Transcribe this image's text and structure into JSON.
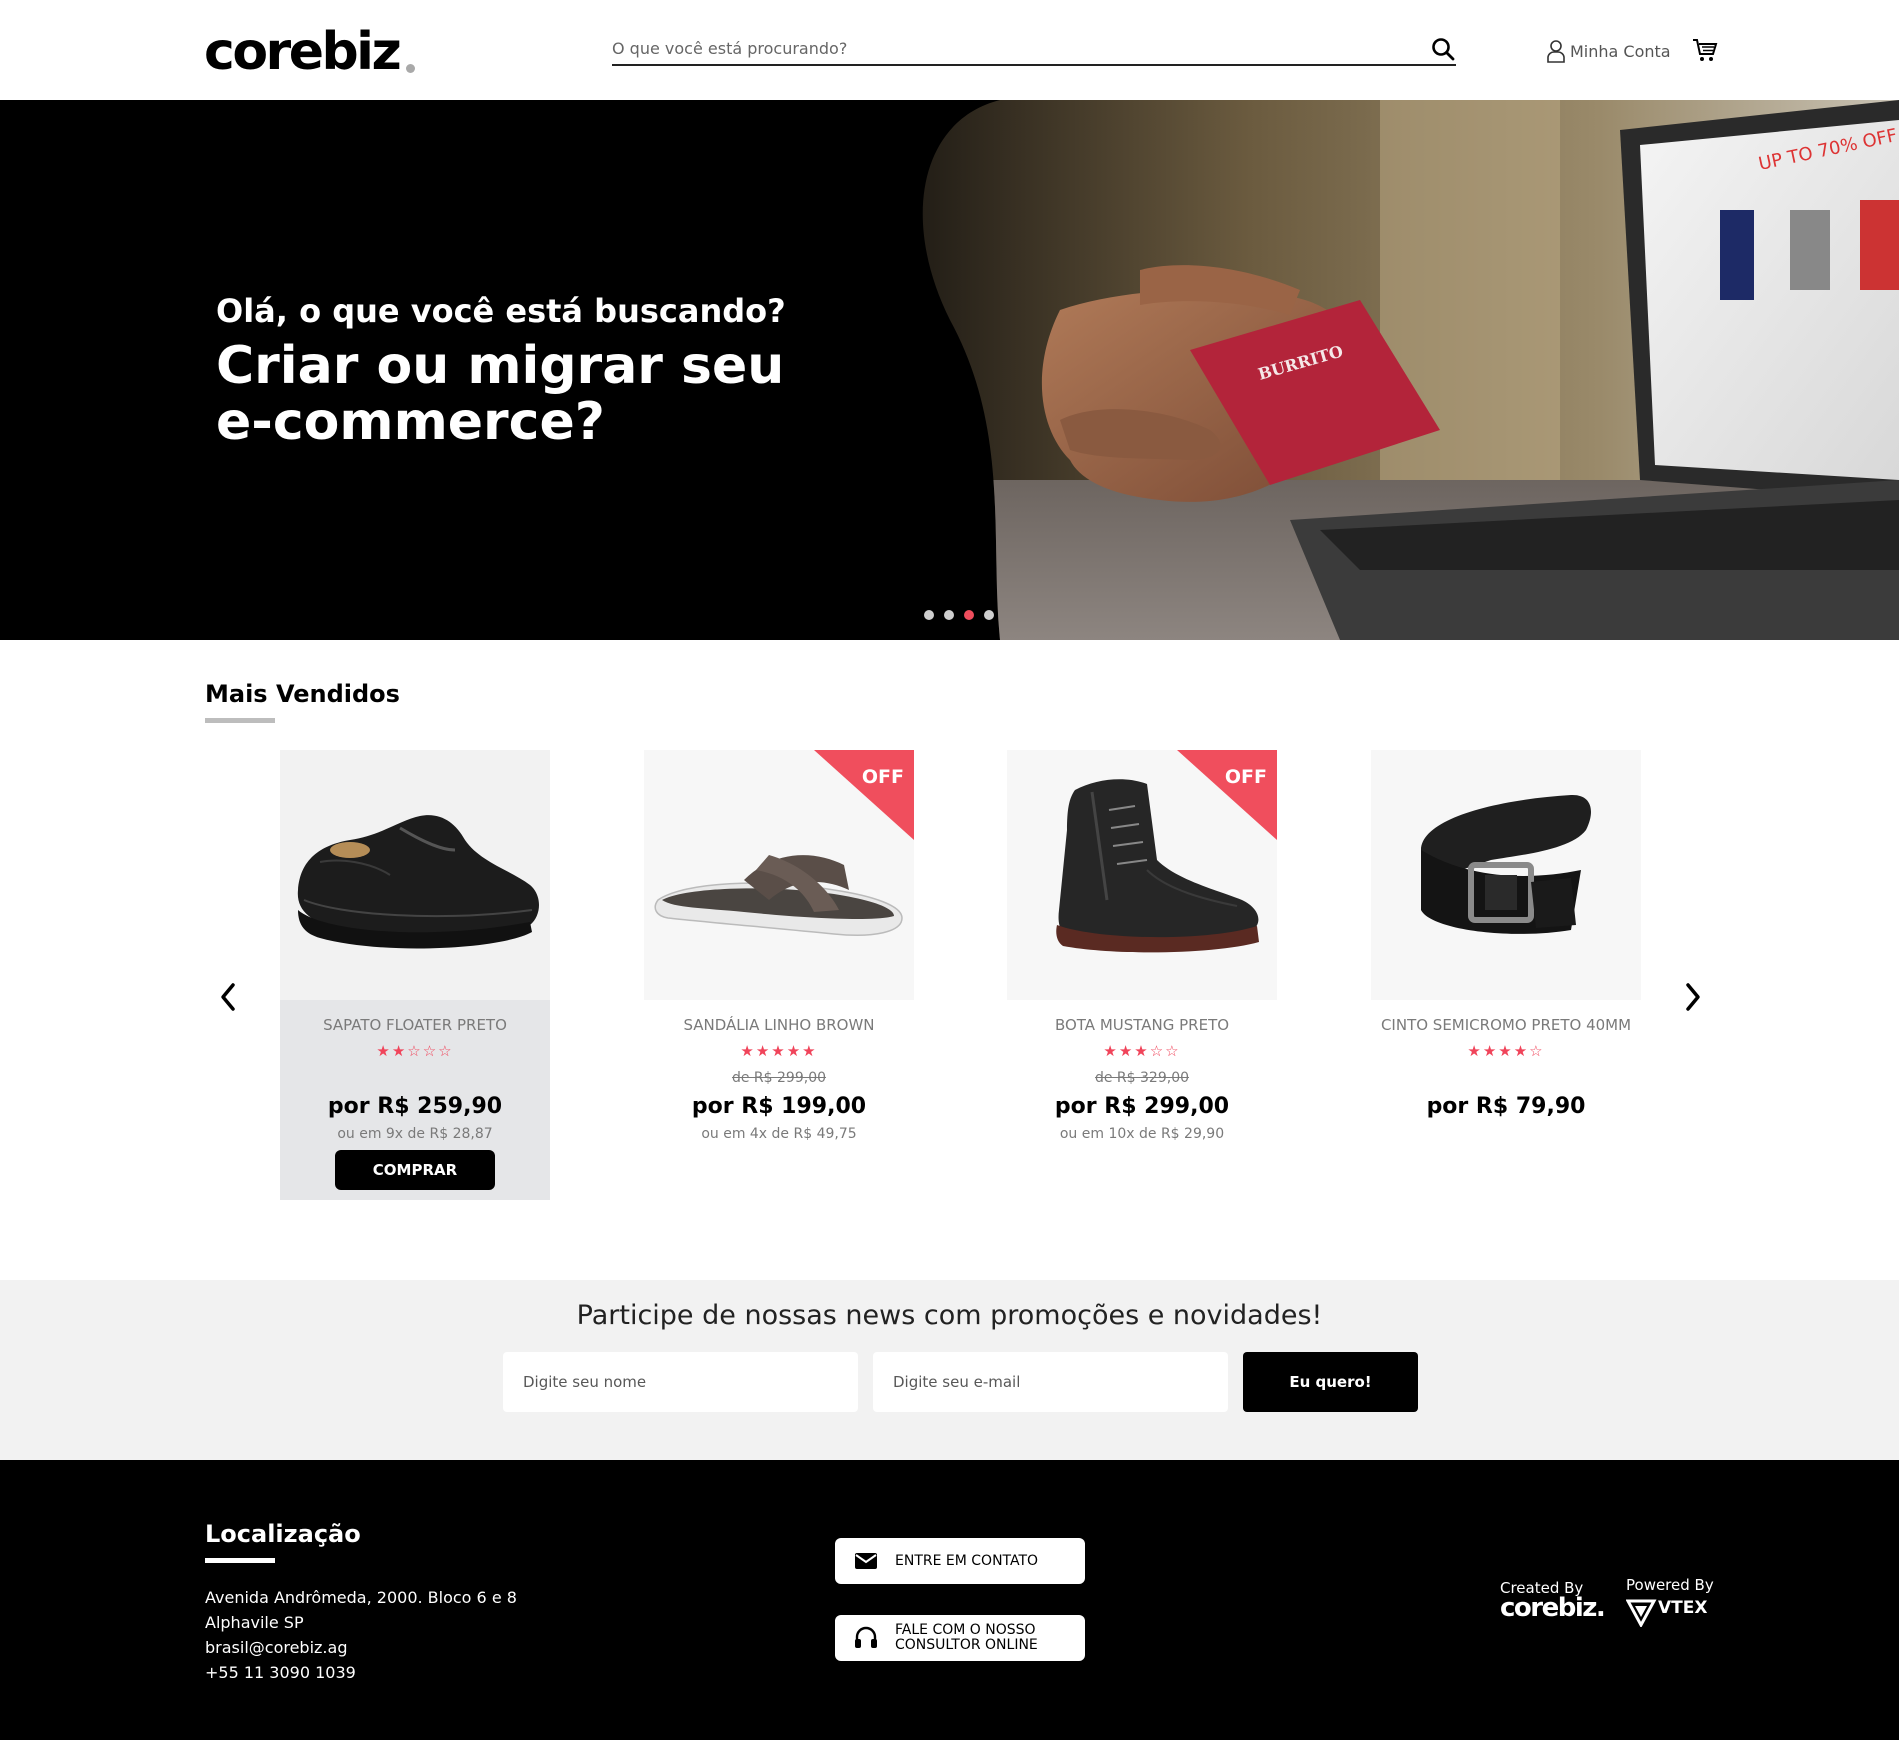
{
  "header": {
    "logo": "corebiz",
    "search_placeholder": "O que você está procurando?",
    "account_label": "Minha Conta"
  },
  "hero": {
    "subtitle": "Olá, o que você está buscando?",
    "title": "Criar ou migrar seu e-commerce?",
    "slides": 4,
    "active_slide": 3
  },
  "best_sellers": {
    "title": "Mais Vendidos",
    "products": [
      {
        "name": "SAPATO FLOATER PRETO",
        "stars": "★★☆☆☆",
        "rating": 2,
        "list_price": "",
        "price": "por R$ 259,90",
        "installments": "ou em 9x de R$ 28,87",
        "off": "",
        "buy": "COMPRAR"
      },
      {
        "name": "SANDÁLIA LINHO BROWN",
        "stars": "★★★★★",
        "rating": 5,
        "list_price": "de R$ 299,00",
        "price": "por R$ 199,00",
        "installments": "ou em 4x de R$ 49,75",
        "off": "OFF"
      },
      {
        "name": "BOTA MUSTANG PRETO",
        "stars": "★★★☆☆",
        "rating": 3,
        "list_price": "de R$ 329,00",
        "price": "por R$ 299,00",
        "installments": "ou em 10x de R$ 29,90",
        "off": "OFF"
      },
      {
        "name": "CINTO SEMICROMO PRETO 40MM",
        "stars": "★★★★☆",
        "rating": 4,
        "list_price": "",
        "price": "por R$ 79,90",
        "installments": "",
        "off": ""
      }
    ]
  },
  "newsletter": {
    "title": "Participe de nossas news com promoções e novidades!",
    "name_placeholder": "Digite seu nome",
    "email_placeholder": "Digite seu e-mail",
    "submit": "Eu quero!"
  },
  "footer": {
    "location_title": "Localização",
    "address_line1": "Avenida Andrômeda, 2000. Bloco 6 e 8",
    "address_line2": "Alphavile SP",
    "email": "brasil@corebiz.ag",
    "phone": "+55 11 3090 1039",
    "contact_button": "ENTRE EM CONTATO",
    "consultant_button_l1": "FALE COM O NOSSO",
    "consultant_button_l2": "CONSULTOR ONLINE",
    "created_by": "Created By",
    "created_logo": "corebiz.",
    "powered_by": "Powered By",
    "vtex": "VTEX"
  },
  "colors": {
    "accent": "#f04e5d",
    "star": "#f0445a",
    "black": "#000000",
    "newsletter_bg": "#f2f2f2"
  }
}
